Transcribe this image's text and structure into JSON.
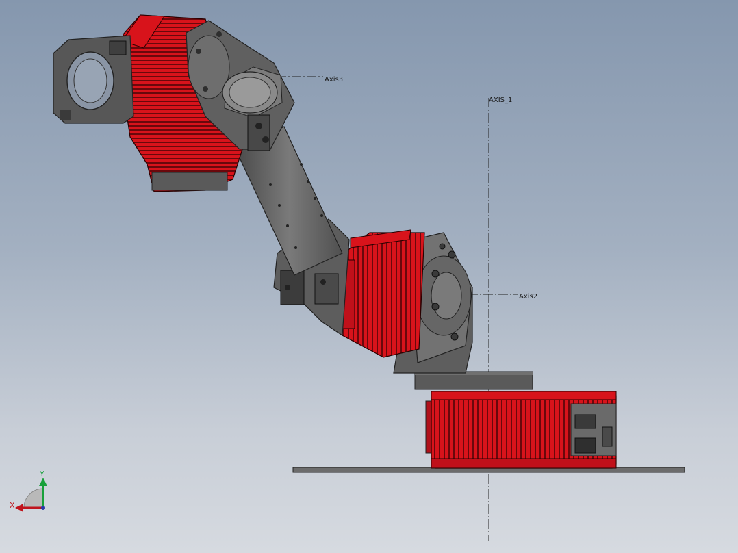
{
  "axes": {
    "axis1": "AXIS_1",
    "axis2": "Axis2",
    "axis3": "Axis3"
  },
  "triad": {
    "x": "X",
    "y": "Y"
  },
  "colors": {
    "motor_red": "#d8131b",
    "motor_dark_red": "#7a0a0e",
    "part_gray": "#666666",
    "part_dark": "#3a3a3a",
    "background_top": "#8597ae",
    "background_bottom": "#d6dae0"
  }
}
